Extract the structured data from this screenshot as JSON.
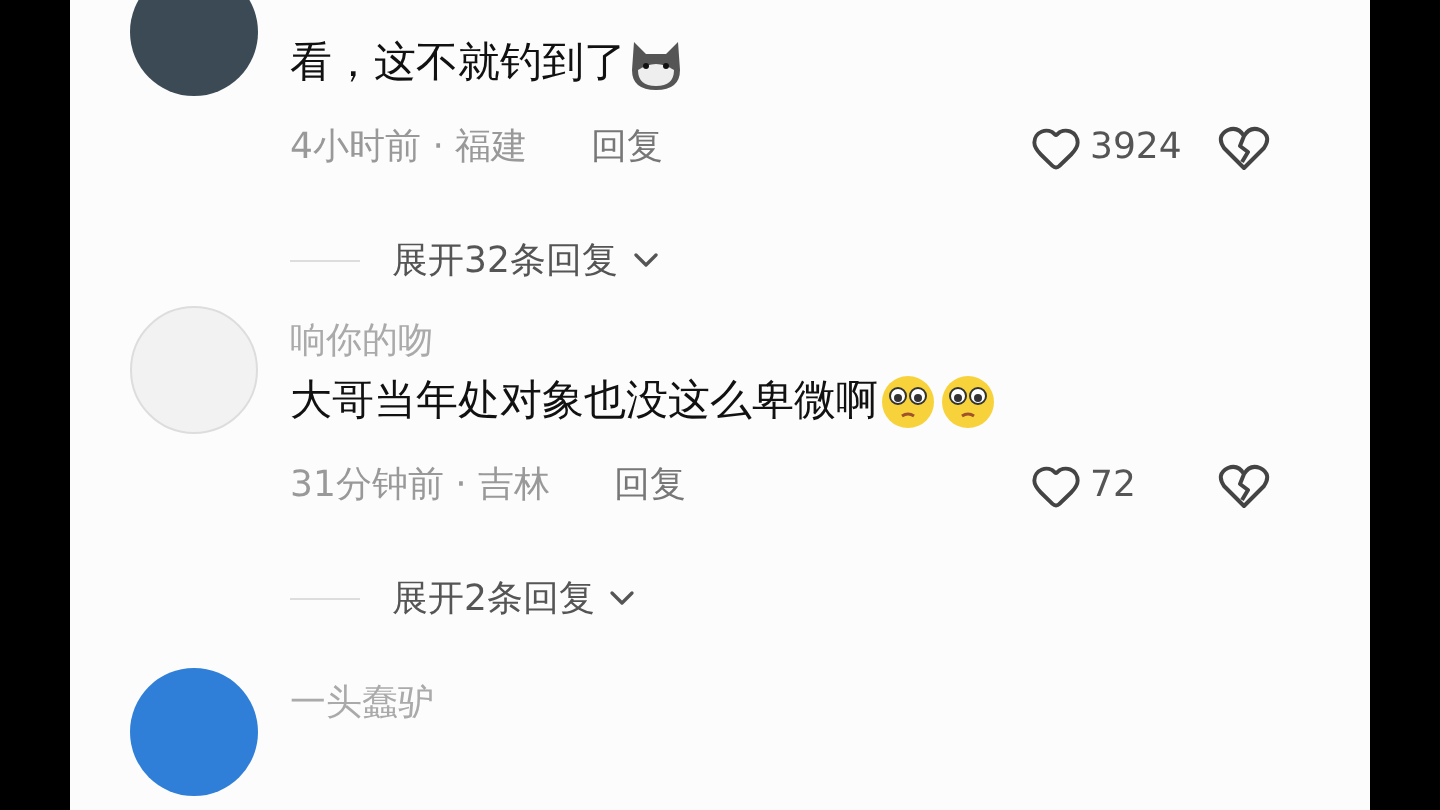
{
  "comments": [
    {
      "kind": "reply_list",
      "text": "看，这不就钓到了",
      "emojis": [
        {
          "kind": "dog"
        }
      ],
      "time": "4小时前",
      "separator": "·",
      "location": "福建",
      "reply_label": "回复",
      "likes": "3924",
      "expand": "展开32条回复"
    },
    {
      "kind": "reply_list",
      "name": "响你的吻",
      "text": "大哥当年处对象也没这么卑微啊",
      "emojis": [
        {
          "kind": "pleading"
        },
        {
          "kind": "pleading"
        }
      ],
      "time": "31分钟前",
      "separator": "·",
      "location": "吉林",
      "reply_label": "回复",
      "likes": "72",
      "expand": "展开2条回复"
    },
    {
      "kind": "partial",
      "name": "一头蠢驴"
    }
  ]
}
